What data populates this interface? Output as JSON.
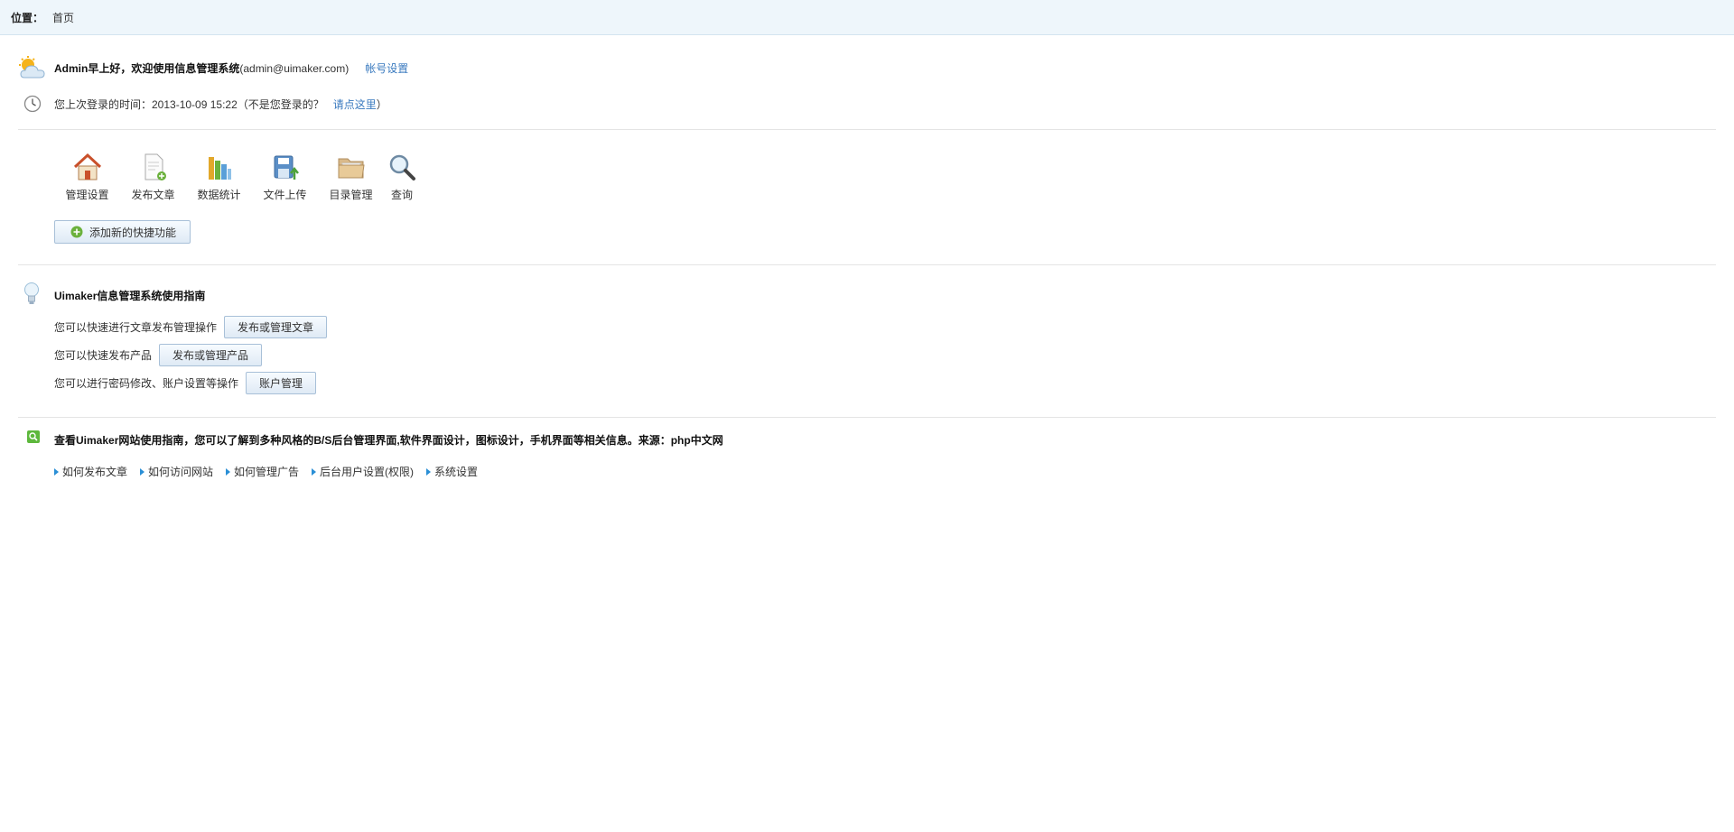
{
  "topbar": {
    "position_label": "位置：",
    "position_value": "首页"
  },
  "welcome": {
    "greeting_bold": "Admin早上好，欢迎使用信息管理系统",
    "email": "(admin@uimaker.com)",
    "account_link": "帐号设置",
    "last_login_text": "您上次登录的时间：2013-10-09 15:22（不是您登录的？",
    "click_here_link": "请点这里",
    "close_paren": "）"
  },
  "shortcuts": {
    "items": [
      {
        "label": "管理设置",
        "icon": "home-icon"
      },
      {
        "label": "发布文章",
        "icon": "new-document-icon"
      },
      {
        "label": "数据统计",
        "icon": "bar-chart-icon"
      },
      {
        "label": "文件上传",
        "icon": "upload-icon"
      },
      {
        "label": "目录管理",
        "icon": "folder-icon"
      },
      {
        "label": "查询",
        "icon": "magnifier-icon"
      }
    ],
    "add_button": "添加新的快捷功能"
  },
  "guide": {
    "title": "Uimaker信息管理系统使用指南",
    "rows": [
      {
        "text": "您可以快速进行文章发布管理操作",
        "button": "发布或管理文章"
      },
      {
        "text": "您可以快速发布产品",
        "button": "发布或管理产品"
      },
      {
        "text": "您可以进行密码修改、账户设置等操作",
        "button": "账户管理"
      }
    ]
  },
  "site": {
    "title": "查看Uimaker网站使用指南，您可以了解到多种风格的B/S后台管理界面,软件界面设计，图标设计，手机界面等相关信息。来源：php中文网",
    "links": [
      "如何发布文章",
      "如何访问网站",
      "如何管理广告",
      "后台用户设置(权限)",
      "系统设置"
    ]
  },
  "colors": {
    "link": "#3a7abf",
    "topbar_bg": "#eef6fb",
    "arrow": "#2a8fd6"
  }
}
